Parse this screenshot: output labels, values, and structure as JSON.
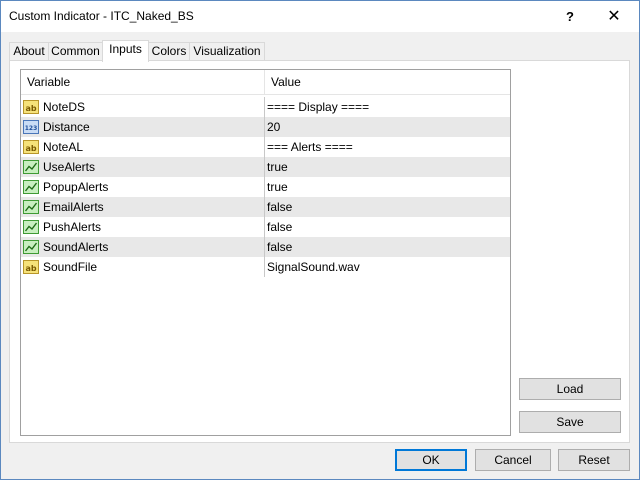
{
  "window": {
    "title": "Custom Indicator - ITC_Naked_BS",
    "help_label": "?",
    "close_label": "✕"
  },
  "tabs": [
    {
      "label": "About",
      "active": false
    },
    {
      "label": "Common",
      "active": false
    },
    {
      "label": "Inputs",
      "active": true
    },
    {
      "label": "Colors",
      "active": false
    },
    {
      "label": "Visualization",
      "active": false
    }
  ],
  "grid": {
    "columns": [
      "Variable",
      "Value"
    ],
    "rows": [
      {
        "icon": "string-icon",
        "name": "NoteDS",
        "value": "==== Display ===="
      },
      {
        "icon": "integer-icon",
        "name": "Distance",
        "value": "20"
      },
      {
        "icon": "string-icon",
        "name": "NoteAL",
        "value": "=== Alerts ===="
      },
      {
        "icon": "boolean-icon",
        "name": "UseAlerts",
        "value": "true"
      },
      {
        "icon": "boolean-icon",
        "name": "PopupAlerts",
        "value": "true"
      },
      {
        "icon": "boolean-icon",
        "name": "EmailAlerts",
        "value": "false"
      },
      {
        "icon": "boolean-icon",
        "name": "PushAlerts",
        "value": "false"
      },
      {
        "icon": "boolean-icon",
        "name": "SoundAlerts",
        "value": "false"
      },
      {
        "icon": "string-icon",
        "name": "SoundFile",
        "value": "SignalSound.wav"
      }
    ]
  },
  "side_buttons": {
    "load": "Load",
    "save": "Save"
  },
  "footer_buttons": {
    "ok": "OK",
    "cancel": "Cancel",
    "reset": "Reset"
  },
  "colors": {
    "accent": "#0078d7",
    "row_alt": "#e8e8e8"
  }
}
